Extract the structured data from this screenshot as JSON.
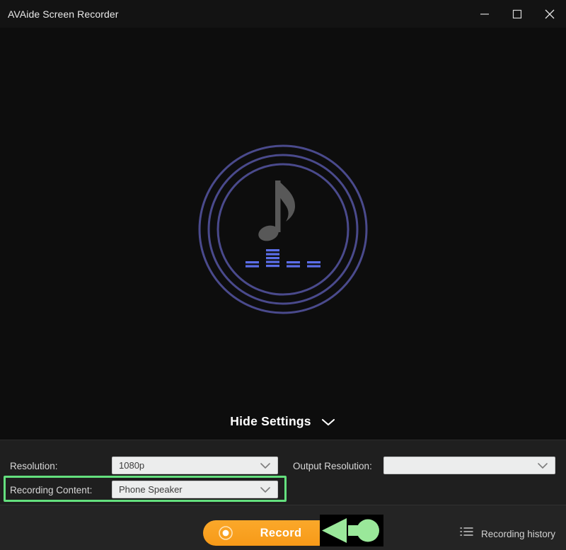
{
  "window": {
    "title": "AVAide Screen Recorder",
    "controls": {
      "minimize": "minimize",
      "maximize": "maximize",
      "close": "close"
    }
  },
  "canvas": {
    "graphic": {
      "type": "audio-recording-visual",
      "note_icon": "music-note-icon",
      "equalizer_icon": "equalizer-bars-icon",
      "ring_color": "#4a4a8c",
      "note_color": "#585858",
      "bar_color": "#5b6ee8",
      "ring_count": 3
    }
  },
  "settings_toggle": {
    "label": "Hide Settings",
    "chevron_icon": "chevron-down-icon"
  },
  "settings": {
    "resolution": {
      "label": "Resolution:",
      "value": "1080p",
      "placeholder": ""
    },
    "output_resolution": {
      "label": "Output Resolution:",
      "value": "",
      "placeholder": ""
    },
    "recording_content": {
      "label": "Recording Content:",
      "value": "Phone Speaker",
      "placeholder": "",
      "highlighted": true,
      "highlight_color": "#64e07e"
    }
  },
  "bottom": {
    "record_button": {
      "label": "Record",
      "icon": "record-dot-icon",
      "color": "#f79a18"
    },
    "recording_history": {
      "label": "Recording history",
      "icon": "list-icon"
    },
    "annotation": {
      "type": "arrow-pointing-left",
      "color": "#9ae89a"
    }
  }
}
